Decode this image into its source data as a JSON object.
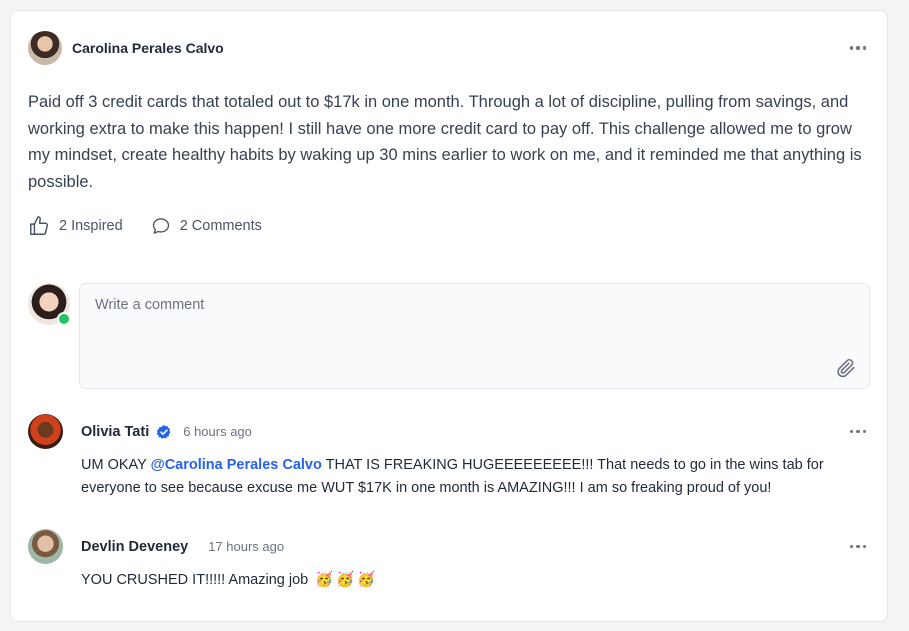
{
  "post": {
    "author": "Carolina Perales Calvo",
    "body": "Paid off 3 credit cards that totaled out to $17k in one month. Through a lot of discipline, pulling from savings, and working extra to make this happen! I still have one more credit card to pay off. This challenge allowed me to grow my mindset, create healthy habits by waking up 30 mins earlier to work on me, and it reminded me that anything is possible.",
    "inspired_label": "2 Inspired",
    "comments_label": "2 Comments",
    "icons": {
      "like": "thumbs-up-icon",
      "comment": "chat-bubble-icon",
      "more": "more-horizontal-icon",
      "attach": "paperclip-icon",
      "verified": "verified-badge-icon"
    }
  },
  "composer": {
    "placeholder": "Write a comment",
    "online_color": "#22c55e"
  },
  "comments": [
    {
      "author": "Olivia Tati",
      "verified": true,
      "time": "6 hours ago",
      "text_prefix": "UM OKAY ",
      "mention": "@Carolina Perales Calvo",
      "text_suffix": " THAT IS FREAKING HUGEEEEEEEEE!!! That needs to go in the wins tab for everyone to see because excuse me WUT $17K in one month is AMAZING!!! I am so freaking proud of you!"
    },
    {
      "author": "Devlin Deveney",
      "verified": false,
      "time": "17 hours ago",
      "text": "YOU CRUSHED IT!!!!! Amazing job",
      "emojis": [
        "🥳",
        "🥳",
        "🥳"
      ]
    }
  ],
  "colors": {
    "mention": "#2563eb",
    "verified": "#2563eb"
  }
}
